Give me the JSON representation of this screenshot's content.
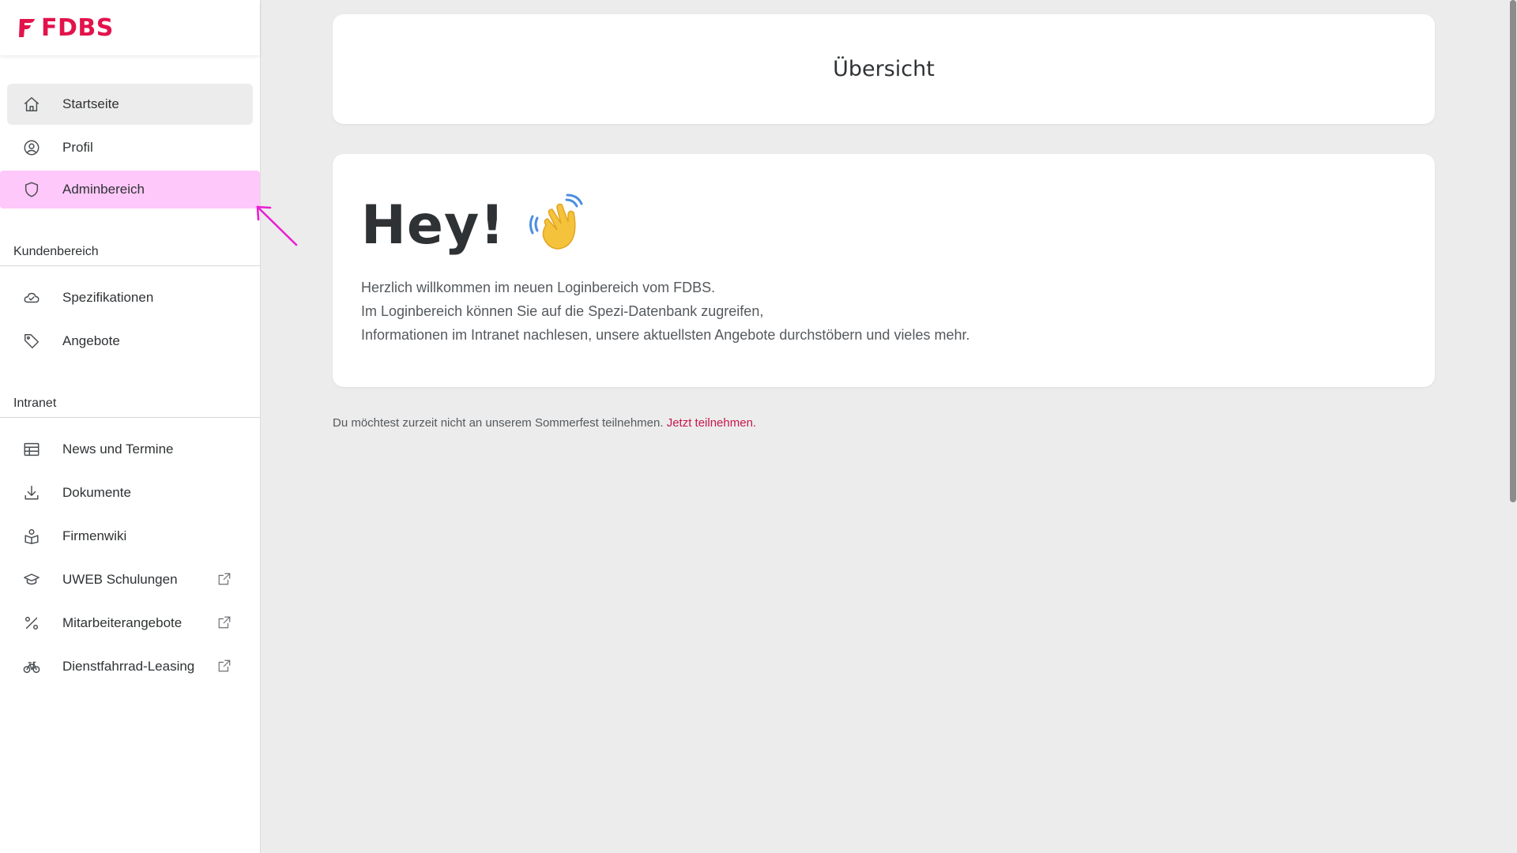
{
  "brand": {
    "name": "FDBS",
    "color": "#e2134b"
  },
  "nav": {
    "main": [
      {
        "label": "Startseite",
        "icon": "home-icon"
      },
      {
        "label": "Profil",
        "icon": "user-circle-icon"
      },
      {
        "label": "Adminbereich",
        "icon": "shield-icon"
      }
    ],
    "sections": [
      {
        "title": "Kundenbereich",
        "items": [
          {
            "label": "Spezifikationen",
            "icon": "cloud-icon"
          },
          {
            "label": "Angebote",
            "icon": "tag-icon"
          }
        ]
      },
      {
        "title": "Intranet",
        "items": [
          {
            "label": "News und Termine",
            "icon": "calendar-table-icon"
          },
          {
            "label": "Dokumente",
            "icon": "download-icon"
          },
          {
            "label": "Firmenwiki",
            "icon": "book-user-icon"
          },
          {
            "label": "UWEB Schulungen",
            "icon": "graduation-cap-icon",
            "external": true
          },
          {
            "label": "Mitarbeiterangebote",
            "icon": "percent-icon",
            "external": true
          },
          {
            "label": "Dienstfahrrad-Leasing",
            "icon": "bicycle-icon",
            "external": true
          }
        ]
      }
    ]
  },
  "page": {
    "title": "Übersicht",
    "greeting": "Hey!",
    "greeting_icon": "waving-hand-icon",
    "welcome_lines": [
      "Herzlich willkommen im neuen Loginbereich vom FDBS.",
      "Im Loginbereich können Sie auf die Spezi-Datenbank zugreifen,",
      "Informationen im Intranet nachlesen, unsere aktuellsten Angebote durchstöbern und vieles mehr."
    ],
    "footer_text": "Du möchtest zurzeit nicht an unserem Sommerfest teilnehmen. ",
    "footer_link": "Jetzt teilnehmen."
  },
  "colors": {
    "highlight": "#ffc8fa",
    "annotation_arrow": "#e91fd4",
    "link": "#c8164d"
  }
}
